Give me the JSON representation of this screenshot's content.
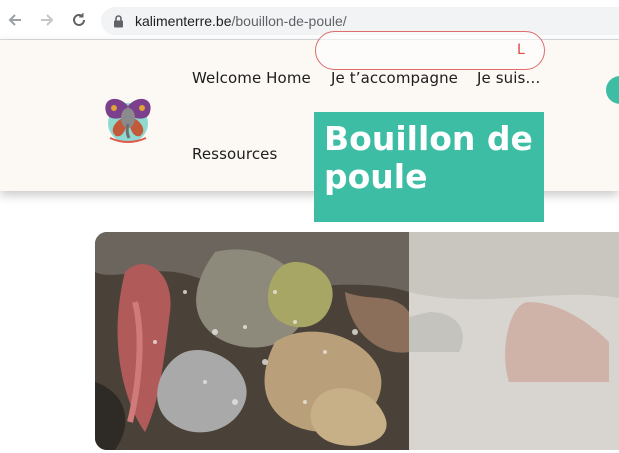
{
  "browser": {
    "url_domain": "kalimenterre.be",
    "url_path": "/bouillon-de-poule/",
    "icons": [
      "back-arrow-icon",
      "forward-arrow-icon",
      "reload-icon",
      "lock-icon"
    ]
  },
  "header": {
    "logo_icon": "elephant-butterfly-logo",
    "menu": [
      {
        "label": "Welcome Home"
      },
      {
        "label": "Je t’accompagne"
      },
      {
        "label": "Je suis…"
      },
      {
        "label": "Ressources"
      }
    ]
  },
  "hero": {
    "tag_label": "L",
    "title_line1": "Bouillon de",
    "title_line2": "poule"
  },
  "colors": {
    "accent": "#3dbea4",
    "header_bg": "#fcf8f4",
    "tag_red": "#d94a3e"
  }
}
